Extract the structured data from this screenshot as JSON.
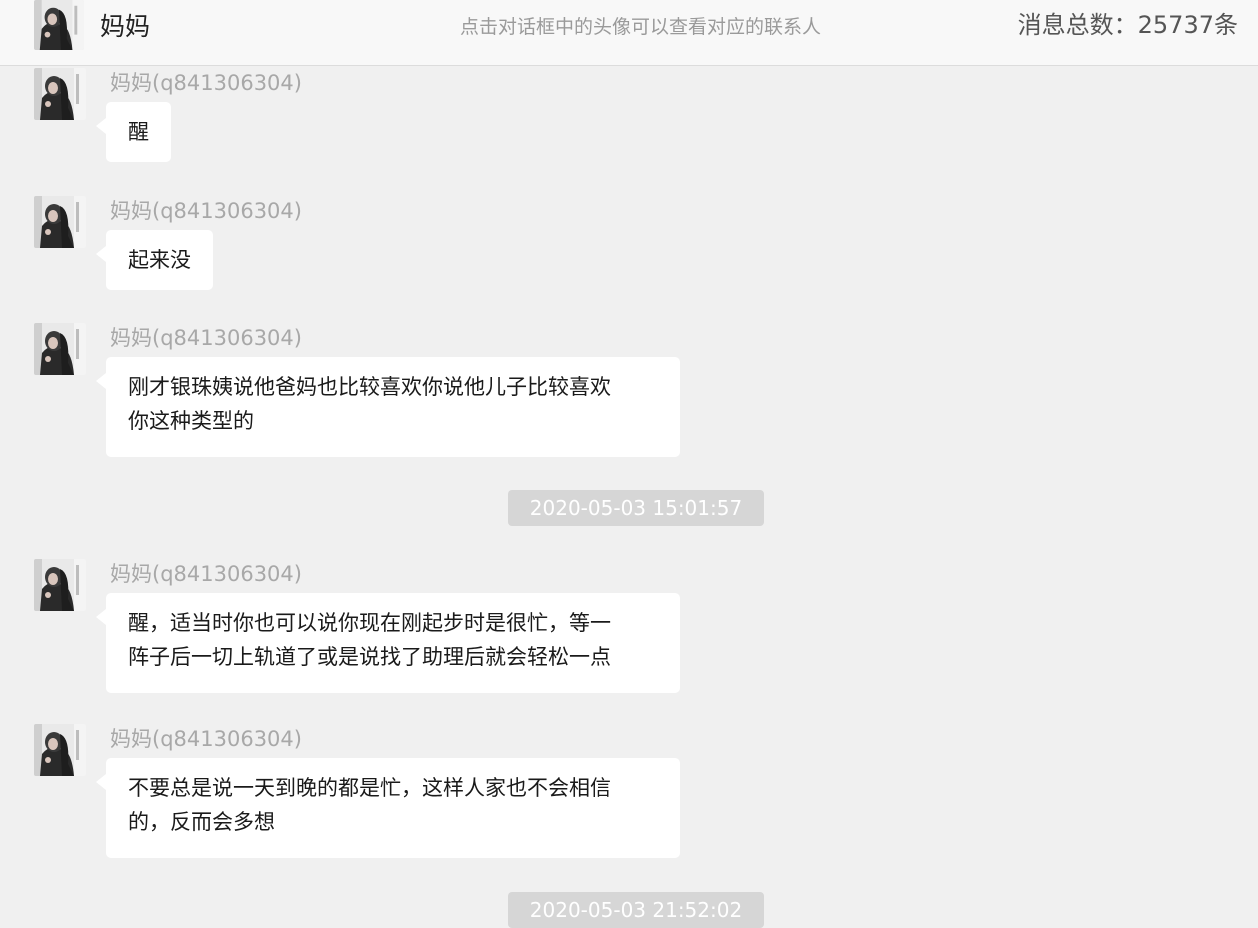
{
  "header": {
    "title": "妈妈",
    "hint": "点击对话框中的头像可以查看对应的联系人",
    "message_count": "消息总数：25737条"
  },
  "messages": [
    {
      "sender": "妈妈(q841306304)",
      "lines": [
        "醒"
      ]
    },
    {
      "sender": "妈妈(q841306304)",
      "lines": [
        "起来没"
      ]
    },
    {
      "sender": "妈妈(q841306304)",
      "lines": [
        "刚才银珠姨说他爸妈也比较喜欢你说他儿子比较喜欢",
        "你这种类型的"
      ]
    },
    {
      "sender": "妈妈(q841306304)",
      "lines": [
        "醒，适当时你也可以说你现在刚起步时是很忙，等一",
        "阵子后一切上轨道了或是说找了助理后就会轻松一点"
      ]
    },
    {
      "sender": "妈妈(q841306304)",
      "lines": [
        "不要总是说一天到晚的都是忙，这样人家也不会相信",
        "的，反而会多想"
      ]
    }
  ],
  "timestamps": [
    "2020-05-03 15:01:57",
    "2020-05-03 21:52:02"
  ],
  "colors": {
    "background": "#f0f0f0",
    "bubble": "#ffffff",
    "timestamp_bg": "#d6d6d6",
    "sender_text": "#a8a8a8"
  },
  "icons": {
    "contact_avatar": "avatar-photo-icon"
  }
}
